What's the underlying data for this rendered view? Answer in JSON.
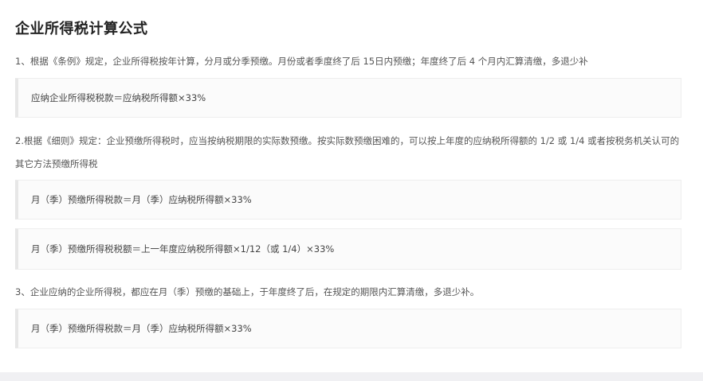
{
  "article": {
    "title": "企业所得税计算公式",
    "para1": "1、根据《条例》规定，企业所得税按年计算，分月或分季预缴。月份或者季度终了后 15日内预缴；年度终了后 4 个月内汇算清缴，多退少补",
    "formula1": "应纳企业所得税税款＝应纳税所得额×33%",
    "para2": "2.根据《细则》规定：企业预缴所得税时，应当按纳税期限的实际数预缴。按实际数预缴困难的，可以按上年度的应纳税所得额的 1/2 或 1/4 或者按税务机关认可的其它方法预缴所得税",
    "formula2": "月（季）预缴所得税款＝月（季）应纳税所得额×33%",
    "formula3": "月（季）预缴所得税税额＝上一年度应纳税所得额×1/12（或 1/4）×33%",
    "para3": "3、企业应纳的企业所得税，都应在月（季）预缴的基础上，于年度终了后，在规定的期限内汇算清缴，多退少补。",
    "formula4": "月（季）预缴所得税款＝月（季）应纳税所得额×33%"
  }
}
